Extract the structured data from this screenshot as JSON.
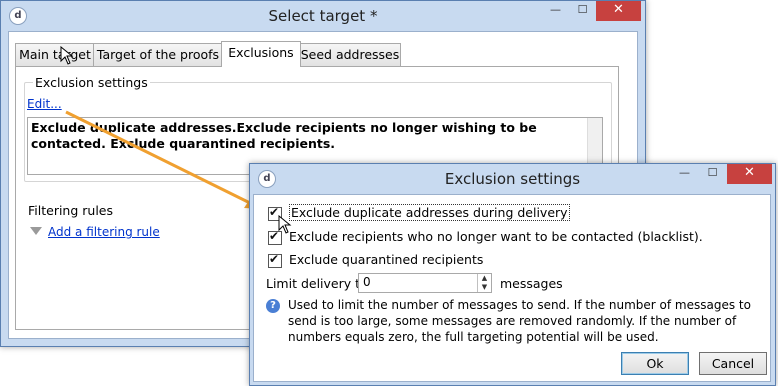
{
  "main_window": {
    "title": "Select target *",
    "tabs": [
      "Main target",
      "Target of the proofs",
      "Exclusions",
      "Seed addresses"
    ],
    "active_tab": "Exclusions",
    "exclusion_settings_label": "Exclusion settings",
    "edit_link": "Edit...",
    "summary_text": "Exclude duplicate addresses.Exclude recipients no longer wishing to be contacted. Exclude quarantined recipients.",
    "filtering_rules_label": "Filtering rules",
    "add_filter_link": "Add a filtering rule"
  },
  "dialog": {
    "title": "Exclusion settings",
    "checkboxes": [
      {
        "label": "Exclude duplicate addresses during delivery",
        "checked": true
      },
      {
        "label": "Exclude recipients who no longer want to be contacted (blacklist).",
        "checked": true
      },
      {
        "label": "Exclude quarantined recipients",
        "checked": true
      }
    ],
    "limit_label": "Limit delivery to:",
    "limit_value": "0",
    "limit_unit": "messages",
    "help_text": "Used to limit the number of messages to send. If the number of messages to send is too large, some messages are removed randomly. If the number of numbers equals zero, the full targeting potential will be used.",
    "ok_label": "Ok",
    "cancel_label": "Cancel"
  },
  "window_controls": {
    "minimize": "—",
    "maximize": "☐",
    "close": "✕"
  },
  "colors": {
    "title_bar": "#c8daf0",
    "close_button": "#c7413f",
    "arrow": "#f0a030",
    "link": "#0033cc"
  },
  "icons": [
    "app-icon",
    "filter-icon",
    "help-icon",
    "mouse-cursor-icon",
    "arrow-connector"
  ]
}
